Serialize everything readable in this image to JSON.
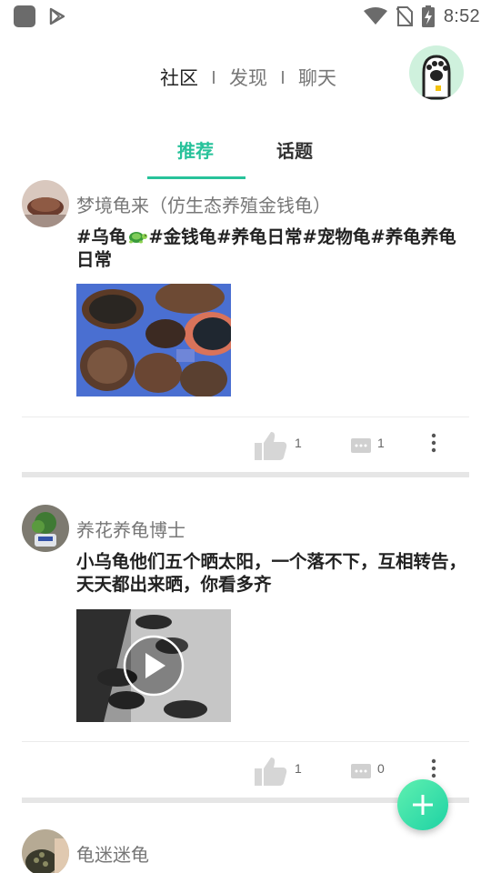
{
  "status_bar": {
    "time": "8:52"
  },
  "top_nav": {
    "tabs": [
      "社区",
      "发现",
      "聊天"
    ],
    "active": 0
  },
  "sub_tabs": {
    "items": [
      "推荐",
      "话题"
    ],
    "active": 0,
    "accent": "#27c29a"
  },
  "posts": [
    {
      "author": "梦境龟来（仿生态养殖金钱龟）",
      "text_parts": [
        "#乌龟",
        "#金钱龟#养龟日常#宠物龟#养龟养龟日常"
      ],
      "emoji": "turtle",
      "media_type": "image",
      "likes": "1",
      "comments": "1"
    },
    {
      "author": "养花养龟博士",
      "text": "小乌龟他们五个晒太阳，一个落不下，互相转告，天天都出来晒，你看多齐",
      "media_type": "video",
      "likes": "1",
      "comments": "0"
    },
    {
      "author": "龟迷迷龟"
    }
  ],
  "fab": {
    "icon": "plus-icon"
  }
}
